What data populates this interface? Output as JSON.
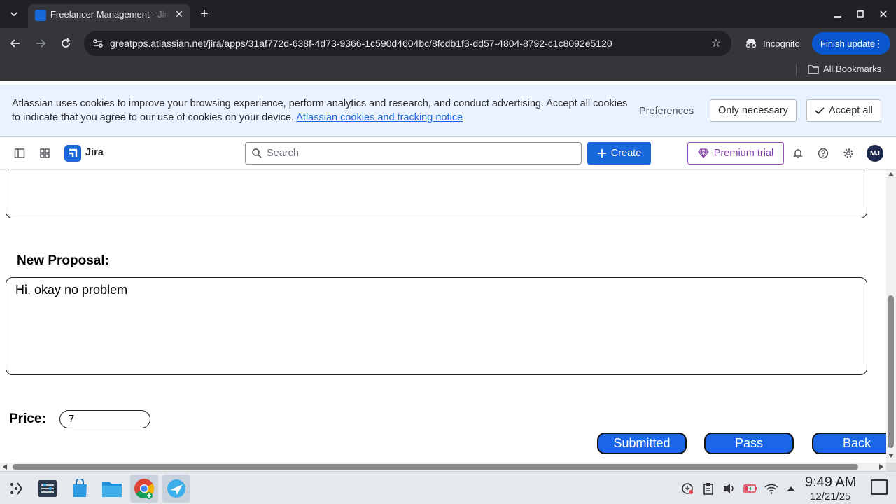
{
  "browser": {
    "tab_title": "Freelancer Management - Jira",
    "tab_close": "✕",
    "new_tab": "+",
    "url": "greatpps.atlassian.net/jira/apps/31af772d-638f-4d73-9366-1c590d4604bc/8fcdb1f3-dd57-4804-8792-c1c8092e5120",
    "incognito_label": "Incognito",
    "finish_update_label": "Finish update",
    "all_bookmarks_label": "All Bookmarks"
  },
  "cookie_banner": {
    "text": "Atlassian uses cookies to improve your browsing experience, perform analytics and research, and conduct advertising. Accept all cookies to indicate that you agree to our use of cookies on your device.",
    "link_text": "Atlassian cookies and tracking notice",
    "preferences_label": "Preferences",
    "only_necessary_label": "Only necessary",
    "accept_all_label": "Accept all"
  },
  "jira_header": {
    "product_name": "Jira",
    "search_placeholder": "Search",
    "create_label": "Create",
    "premium_label": "Premium trial",
    "avatar_initials": "MJ"
  },
  "form": {
    "proposal_label": "New Proposal:",
    "proposal_text": "Hi, okay no problem",
    "price_label": "Price:",
    "price_value": "7",
    "buttons": {
      "submitted": "Submitted",
      "pass": "Pass",
      "back": "Back"
    }
  },
  "taskbar": {
    "time": "9:49 AM",
    "date": "12/21/25"
  },
  "colors": {
    "brand_blue": "#1868db",
    "action_button_blue": "#1b66e6",
    "premium_purple": "#803fa5",
    "cookie_banner_bg": "#e9f2fe"
  }
}
